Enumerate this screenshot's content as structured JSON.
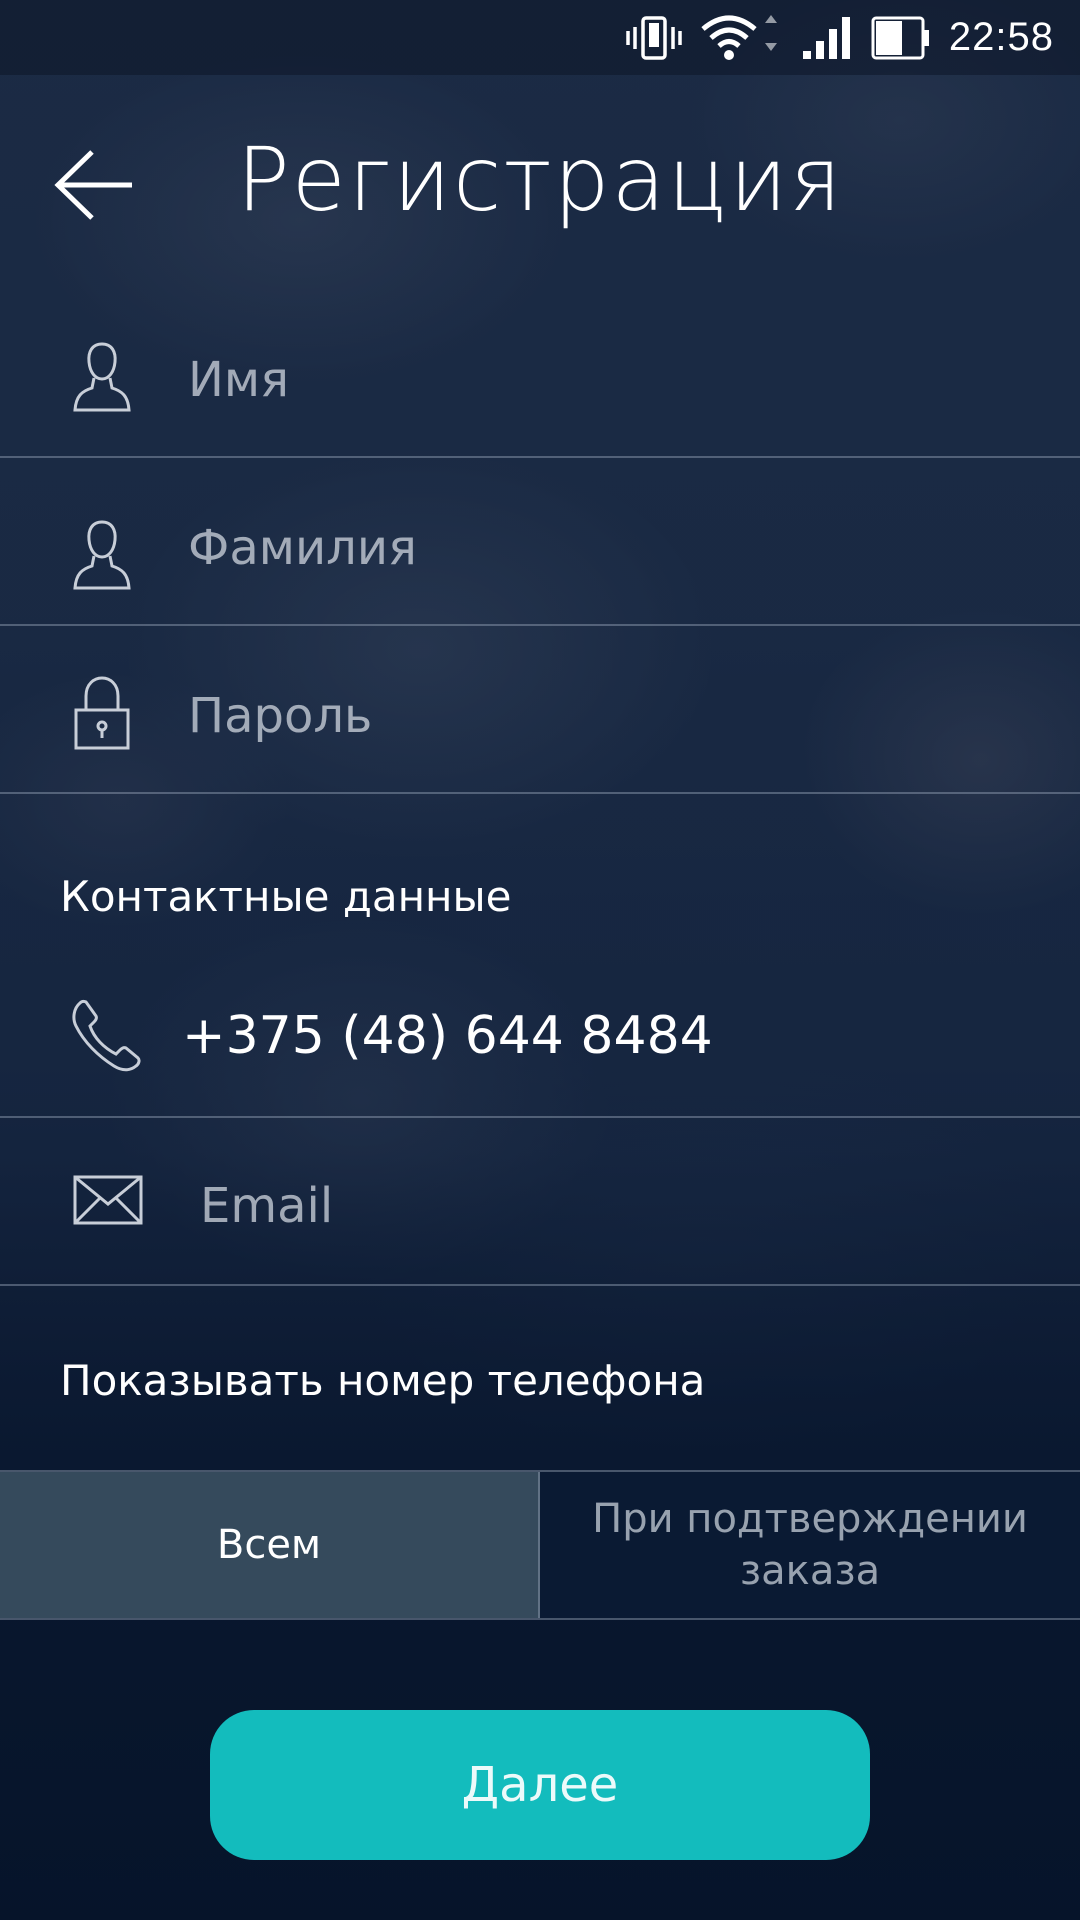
{
  "status_bar": {
    "time": "22:58",
    "icons": [
      "vibrate-icon",
      "wifi-icon",
      "signal-icon",
      "battery-icon"
    ]
  },
  "header": {
    "back_icon": "arrow-left-icon",
    "title": "Регистрация"
  },
  "form": {
    "first_name": {
      "icon": "user-icon",
      "placeholder": "Имя"
    },
    "last_name": {
      "icon": "user-icon",
      "placeholder": "Фамилия"
    },
    "password": {
      "icon": "lock-icon",
      "placeholder": "Пароль"
    }
  },
  "contacts": {
    "section_label": "Контактные данные",
    "phone": {
      "icon": "phone-icon",
      "value": "+375 (48) 644 8484"
    },
    "email": {
      "icon": "envelope-icon",
      "placeholder": "Email"
    }
  },
  "phone_visibility": {
    "label": "Показывать номер телефона",
    "options": [
      "Всем",
      "При подтверждении\nзаказа"
    ],
    "selected": "Всем"
  },
  "actions": {
    "next_label": "Далее"
  },
  "colors": {
    "accent": "#13bcbd",
    "segment_active": "#354a5c",
    "segment_inactive": "#0a1a33"
  }
}
